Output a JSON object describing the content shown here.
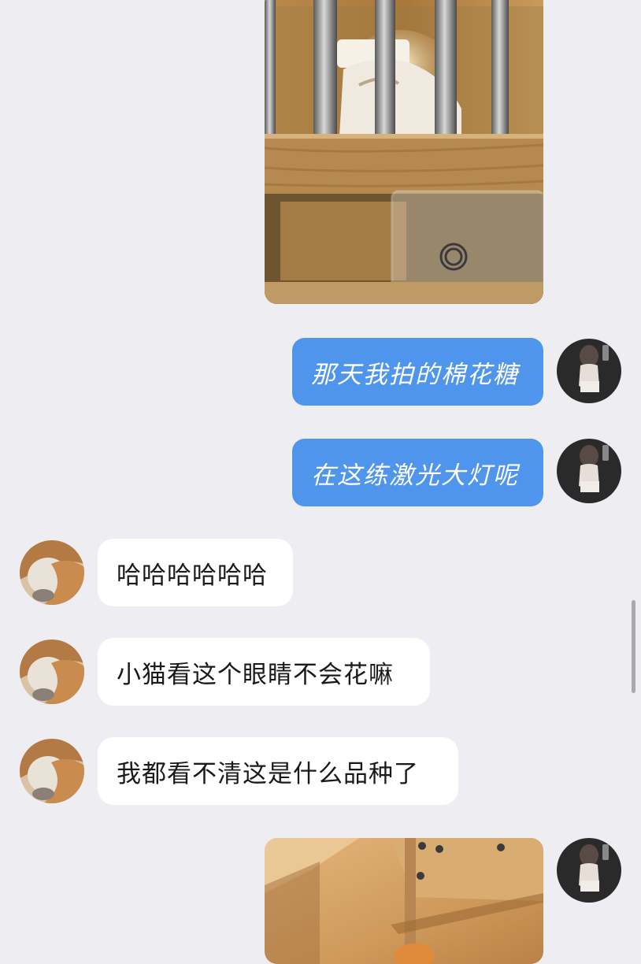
{
  "messages": [
    {
      "sender": "self",
      "type": "image",
      "description": "cat-in-display-cabinet-photo"
    },
    {
      "sender": "self",
      "type": "text",
      "text": "那天我拍的棉花糖"
    },
    {
      "sender": "self",
      "type": "text",
      "text": "在这练激光大灯呢"
    },
    {
      "sender": "other",
      "type": "text",
      "text": "哈哈哈哈哈哈"
    },
    {
      "sender": "other",
      "type": "text",
      "text": "小猫看这个眼睛不会花嘛"
    },
    {
      "sender": "other",
      "type": "text",
      "text": "我都看不清这是什么品种了"
    },
    {
      "sender": "self",
      "type": "image",
      "description": "orange-cat-in-wooden-cabinet-photo"
    }
  ],
  "colors": {
    "background": "#eeedf2",
    "outgoing_bubble": "#4f95eb",
    "incoming_bubble": "#ffffff",
    "outgoing_text": "#ffffff",
    "incoming_text": "#1a1a1a"
  }
}
